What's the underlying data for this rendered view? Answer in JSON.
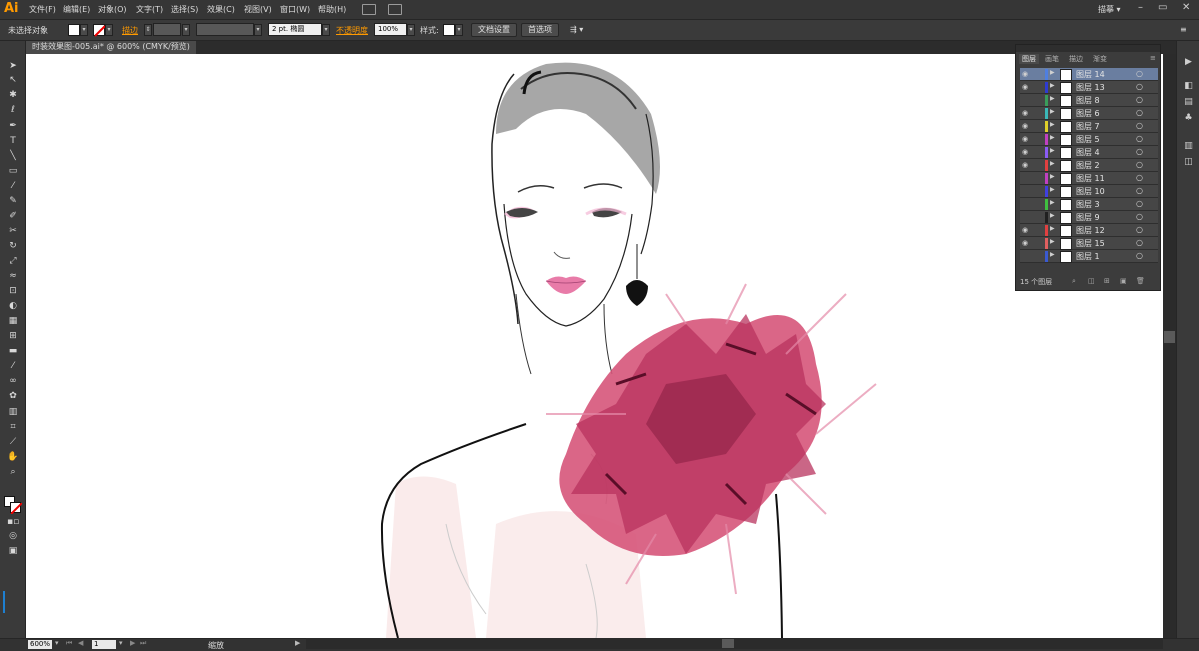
{
  "app": {
    "logo": "Ai",
    "workspace": "描摹 ▾"
  },
  "menu": [
    "文件(F)",
    "编辑(E)",
    "对象(O)",
    "文字(T)",
    "选择(S)",
    "效果(C)",
    "视图(V)",
    "窗口(W)",
    "帮助(H)"
  ],
  "window_controls": {
    "minimize": "–",
    "restore": "▭",
    "close": "✕"
  },
  "control_bar": {
    "selection_status": "未选择对象",
    "stroke_label": "描边",
    "stroke_weight": "2 pt. 椭圆",
    "opacity_label": "不透明度",
    "opacity_value": "100%",
    "style_label": "样式:",
    "doc_setup_button": "文档设置",
    "preferences_button": "首选项"
  },
  "document_tab": "时装效果图-005.ai* @ 600% (CMYK/预览)",
  "layers_panel": {
    "tabs": [
      "图层",
      "画笔",
      "描边",
      "渐变"
    ],
    "active_tab": "图层",
    "layers": [
      {
        "name": "图层 14",
        "visible": true,
        "color": "#4f7fe0",
        "selected": true
      },
      {
        "name": "图层 13",
        "visible": true,
        "color": "#2e3bd0"
      },
      {
        "name": "图层 8",
        "visible": false,
        "color": "#3a9c5a"
      },
      {
        "name": "图层 6",
        "visible": true,
        "color": "#3bb8b8"
      },
      {
        "name": "图层 7",
        "visible": true,
        "color": "#e0d02a"
      },
      {
        "name": "图层 5",
        "visible": true,
        "color": "#c040c0"
      },
      {
        "name": "图层 4",
        "visible": true,
        "color": "#8b5cf6"
      },
      {
        "name": "图层 2",
        "visible": true,
        "color": "#e04040"
      },
      {
        "name": "图层 11",
        "visible": false,
        "color": "#c040c0"
      },
      {
        "name": "图层 10",
        "visible": false,
        "color": "#4040e0"
      },
      {
        "name": "图层 3",
        "visible": false,
        "color": "#40c040"
      },
      {
        "name": "图层 9",
        "visible": false,
        "color": "#202020"
      },
      {
        "name": "图层 12",
        "visible": true,
        "color": "#e04040"
      },
      {
        "name": "图层 15",
        "visible": true,
        "color": "#e06060"
      },
      {
        "name": "图层 1",
        "visible": false,
        "color": "#3a5ad0"
      }
    ],
    "count": "15 个图层"
  },
  "status_bar": {
    "zoom": "600%",
    "page": "1",
    "tool_status": "缩放"
  },
  "colors": {
    "accent_orange": "#ff9a00",
    "selection_blue": "#6a7ea0",
    "flower_pink": "#d6557a",
    "lip_pink": "#e87ba8"
  }
}
